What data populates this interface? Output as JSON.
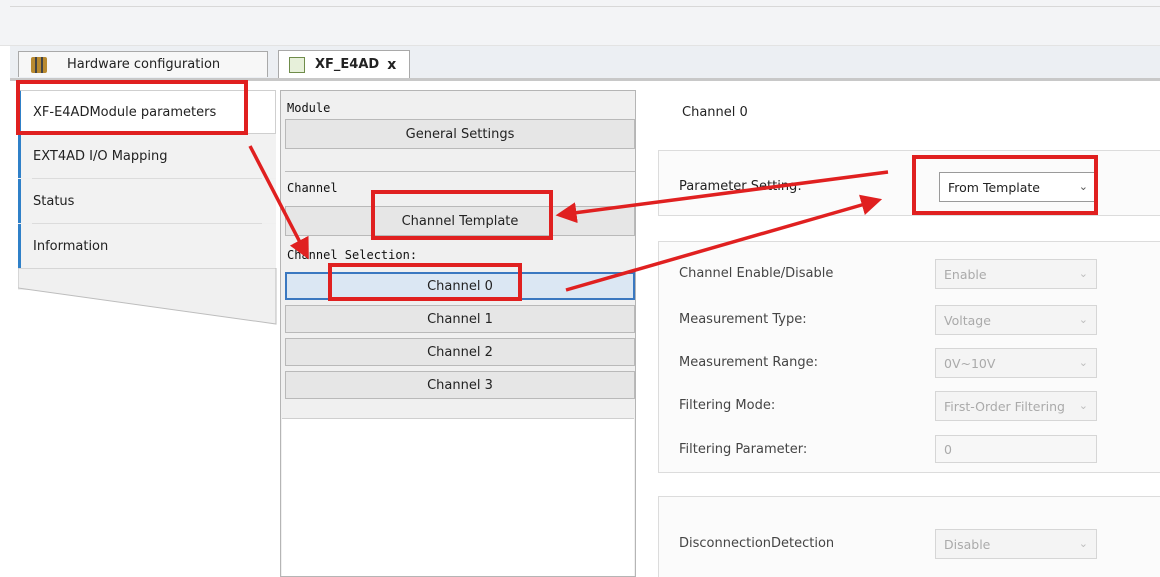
{
  "tabs": [
    {
      "label": "Hardware configuration",
      "icon": "hardware-config-icon"
    },
    {
      "label": "XF_E4AD",
      "icon": "module-icon",
      "close": "x"
    }
  ],
  "nav": {
    "items": [
      {
        "label": "XF-E4ADModule parameters",
        "active": true
      },
      {
        "label": "EXT4AD I/O Mapping"
      },
      {
        "label": "Status"
      },
      {
        "label": "Information"
      }
    ]
  },
  "middle": {
    "module_label": "Module",
    "general_settings": "General Settings",
    "channel_label": "Channel",
    "channel_template": "Channel Template",
    "channel_selection_label": "Channel Selection:",
    "channels": [
      "Channel 0",
      "Channel 1",
      "Channel 2",
      "Channel 3"
    ]
  },
  "right": {
    "title": "Channel 0",
    "parameter_setting": {
      "label": "Parameter Setting:",
      "value": "From Template"
    },
    "rows": [
      {
        "label": "Channel Enable/Disable",
        "value": "Enable"
      },
      {
        "label": "Measurement Type:",
        "value": "Voltage"
      },
      {
        "label": "Measurement Range:",
        "value": "0V~10V"
      },
      {
        "label": "Filtering Mode:",
        "value": "First-Order Filtering"
      },
      {
        "label": "Filtering Parameter:",
        "value": "0"
      }
    ],
    "disconnection": {
      "label": "DisconnectionDetection",
      "value": "Disable"
    }
  },
  "colors": {
    "annotation": "#e02020",
    "accent": "#2f80c8",
    "selected_border": "#3a78c0"
  }
}
